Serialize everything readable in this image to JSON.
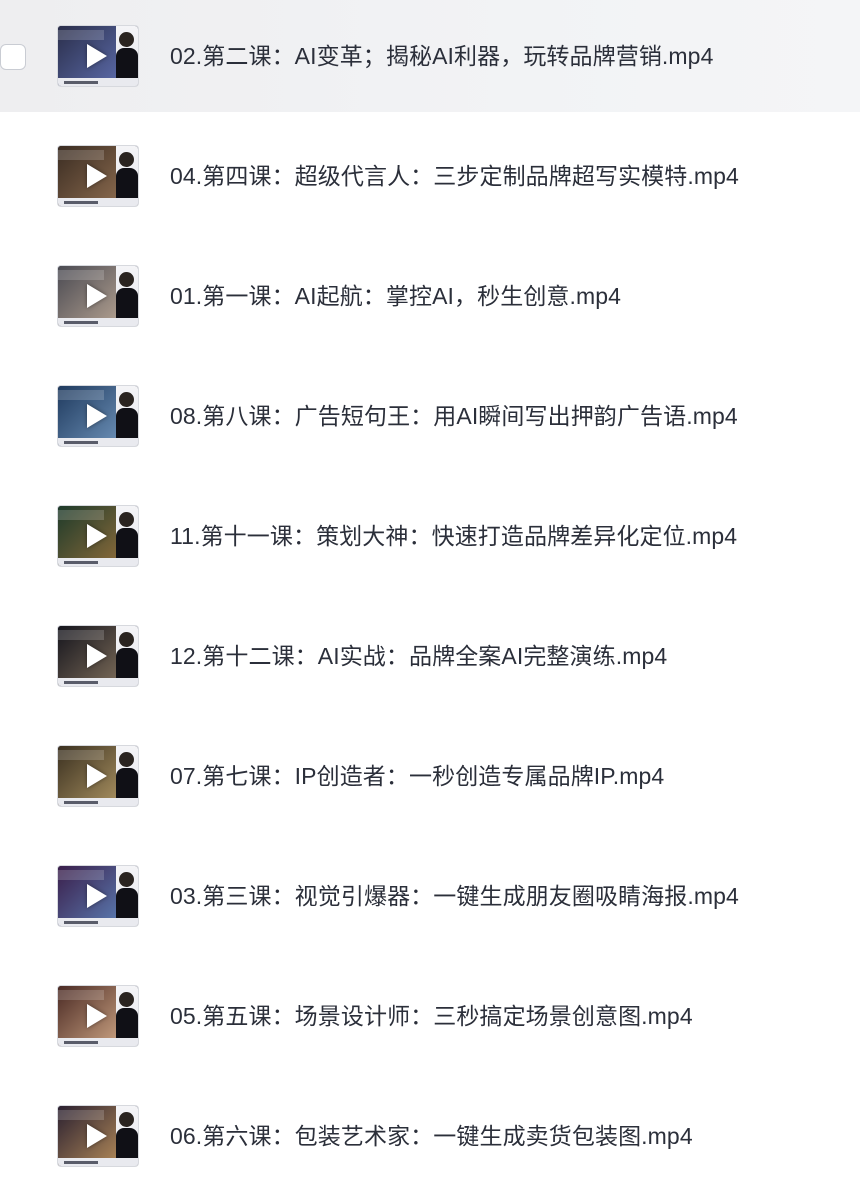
{
  "file_list": {
    "items": [
      {
        "name": "02.第二课：AI变革；揭秘AI利器，玩转品牌营销.mp4",
        "thumb_colors": [
          "#2a2e4a",
          "#5b6aa8"
        ],
        "hovered": true
      },
      {
        "name": "04.第四课：超级代言人：三步定制品牌超写实模特.mp4",
        "thumb_colors": [
          "#3a2c22",
          "#8a6a4e"
        ],
        "hovered": false
      },
      {
        "name": "01.第一课：AI起航：掌控AI，秒生创意.mp4",
        "thumb_colors": [
          "#4a4a52",
          "#b2a090"
        ],
        "hovered": false
      },
      {
        "name": "08.第八课：广告短句王：用AI瞬间写出押韵广告语.mp4",
        "thumb_colors": [
          "#1f3a5e",
          "#6b8fb6"
        ],
        "hovered": false
      },
      {
        "name": "11.第十一课：策划大神：快速打造品牌差异化定位.mp4",
        "thumb_colors": [
          "#1d3a2a",
          "#8a6a3a"
        ],
        "hovered": false
      },
      {
        "name": "12.第十二课：AI实战：品牌全案AI完整演练.mp4",
        "thumb_colors": [
          "#14141c",
          "#7a6a58"
        ],
        "hovered": false
      },
      {
        "name": "07.第七课：IP创造者：一秒创造专属品牌IP.mp4",
        "thumb_colors": [
          "#3a3020",
          "#a89060"
        ],
        "hovered": false
      },
      {
        "name": "03.第三课：视觉引爆器：一键生成朋友圈吸睛海报.mp4",
        "thumb_colors": [
          "#3a1e4a",
          "#5a7ab0"
        ],
        "hovered": false
      },
      {
        "name": "05.第五课：场景设计师：三秒搞定场景创意图.mp4",
        "thumb_colors": [
          "#4a2a24",
          "#c8a080"
        ],
        "hovered": false
      },
      {
        "name": "06.第六课：包装艺术家：一键生成卖货包装图.mp4",
        "thumb_colors": [
          "#2a2030",
          "#b08858"
        ],
        "hovered": false
      }
    ]
  }
}
